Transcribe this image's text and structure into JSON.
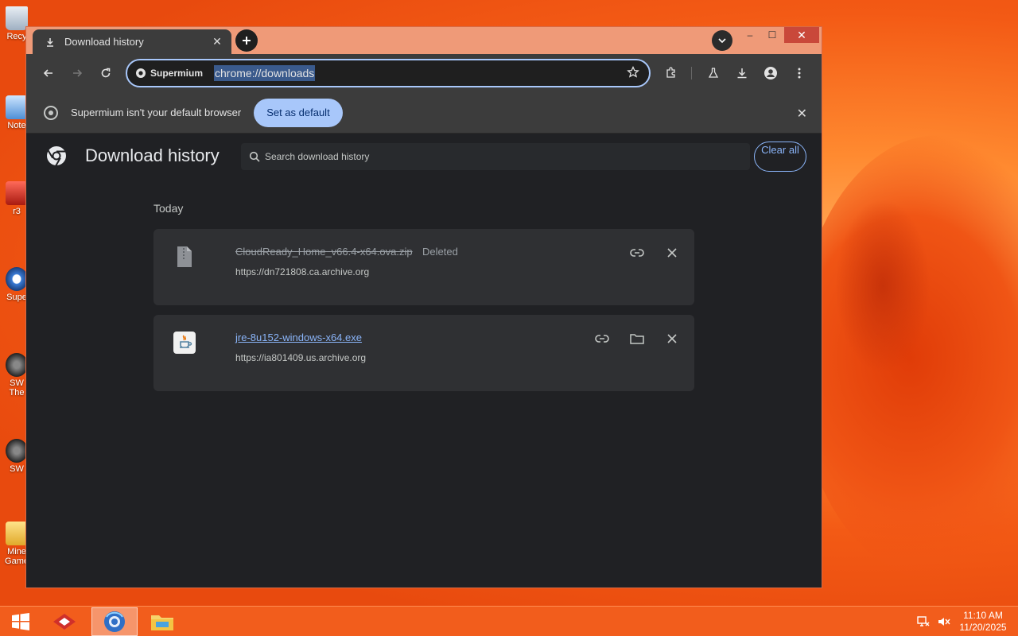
{
  "desktop": {
    "icons": [
      "Recy",
      "Note",
      "r3",
      "Supe",
      "SW The",
      "SW",
      "Mine Game"
    ]
  },
  "browser": {
    "tab": {
      "title": "Download history",
      "icon": "download-icon",
      "close": "✕"
    },
    "window_controls": {
      "minimize": "–",
      "maximize": "☐",
      "close": "✕"
    },
    "omnibox": {
      "chip_label": "Supermium",
      "url": "chrome://downloads"
    },
    "infobar": {
      "message": "Supermium isn't your default browser",
      "button": "Set as default",
      "close": "✕"
    }
  },
  "downloads": {
    "title": "Download history",
    "search_placeholder": "Search download history",
    "clear_all": "Clear all",
    "section": "Today",
    "items": [
      {
        "filename": "CloudReady_Home_v66.4-x64.ova.zip",
        "status": "Deleted",
        "source": "https://dn721808.ca.archive.org",
        "icon": "zip-file-icon"
      },
      {
        "filename": "jre-8u152-windows-x64.exe",
        "status": "",
        "source": "https://ia801409.us.archive.org",
        "icon": "java-icon"
      }
    ]
  },
  "taskbar": {
    "time": "11:10 AM",
    "date": "11/20/2025"
  },
  "colors": {
    "accent": "#a8c7fa",
    "link": "#8ab4f8",
    "page_bg": "#202124",
    "card_bg": "#2f3033",
    "chrome_bg": "#3c3c3c",
    "desktop_orange": "#ee4a10"
  }
}
